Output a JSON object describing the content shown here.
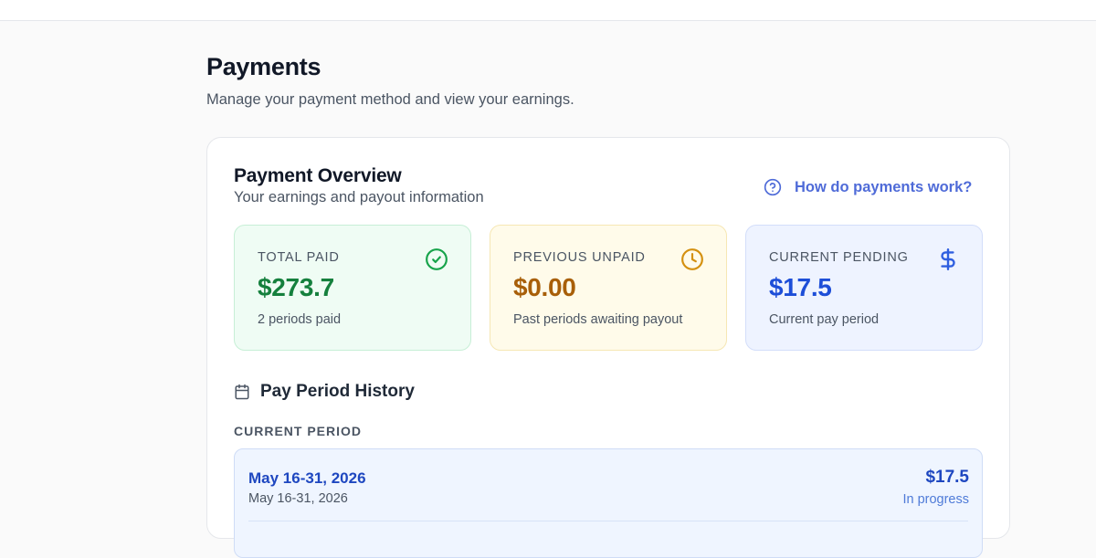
{
  "page": {
    "title": "Payments",
    "subtitle": "Manage your payment method and view your earnings."
  },
  "overview": {
    "title": "Payment Overview",
    "subtitle": "Your earnings and payout information",
    "help_link": "How do payments work?",
    "help_icon": "help-circle-icon"
  },
  "stats": {
    "total_paid": {
      "label": "TOTAL PAID",
      "value": "$273.7",
      "note": "2 periods paid",
      "icon": "check-circle-icon",
      "color": "#15803d"
    },
    "previous_unpaid": {
      "label": "PREVIOUS UNPAID",
      "value": "$0.00",
      "note": "Past periods awaiting payout",
      "icon": "clock-icon",
      "color": "#a85f09"
    },
    "current_pending": {
      "label": "CURRENT PENDING",
      "value": "$17.5",
      "note": "Current pay period",
      "icon": "dollar-icon",
      "color": "#1d4ed8"
    }
  },
  "history": {
    "title": "Pay Period History",
    "icon": "calendar-icon",
    "current_label": "CURRENT PERIOD",
    "current_period": {
      "title": "May 16-31, 2026",
      "subtitle": "May 16-31, 2026",
      "amount": "$17.5",
      "status": "In progress"
    }
  }
}
